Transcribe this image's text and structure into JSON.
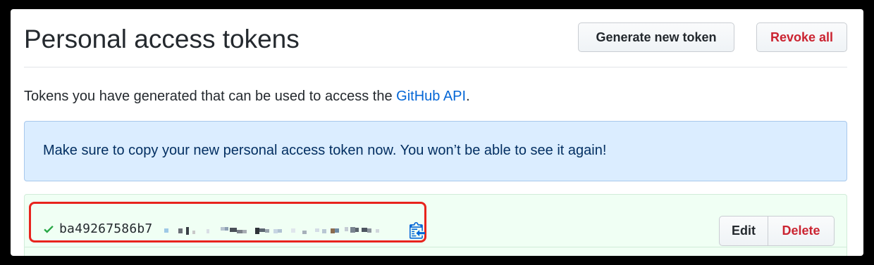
{
  "header": {
    "title": "Personal access tokens",
    "generate_label": "Generate new token",
    "revoke_label": "Revoke all"
  },
  "description": {
    "text_before": "Tokens you have generated that can be used to access the ",
    "link_text": "GitHub API",
    "text_after": "."
  },
  "flash": {
    "message": "Make sure to copy your new personal access token now. You won’t be able to see it again!"
  },
  "token": {
    "visible_prefix": "ba49267586b7",
    "status_icon": "check-icon",
    "copy_icon": "clipboard-icon",
    "edit_label": "Edit",
    "delete_label": "Delete"
  },
  "colors": {
    "link": "#0366d6",
    "danger": "#cb2431",
    "success": "#28a745",
    "flash_bg": "#dbedff",
    "token_bg": "#f0fff4",
    "highlight": "#e8231d"
  }
}
